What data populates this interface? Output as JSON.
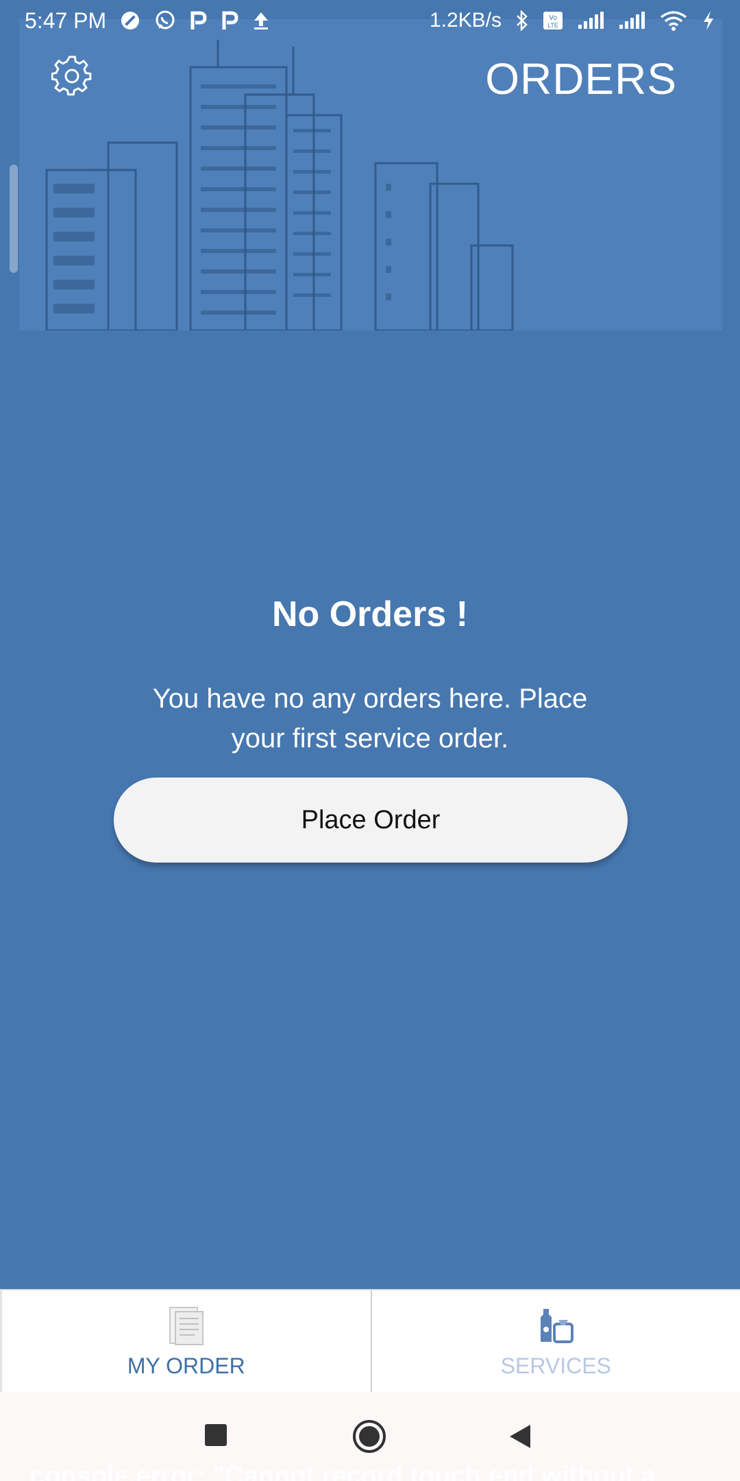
{
  "status_bar": {
    "time": "5:47 PM",
    "net_speed": "1.2KB/s",
    "icons": [
      "dnd-icon",
      "whatsapp-icon",
      "p-app-icon",
      "p-app-icon",
      "upload-icon",
      "bluetooth-icon",
      "volte-icon",
      "signal-icon",
      "signal-icon",
      "wifi-icon",
      "charging-icon"
    ]
  },
  "header": {
    "title": "ORDERS",
    "settings_icon": "gear-icon"
  },
  "empty_state": {
    "title": "No Orders !",
    "message": "You have no any orders here. Place your first service order.",
    "button_label": "Place Order"
  },
  "bottom_nav": {
    "items": [
      {
        "label": "MY ORDER",
        "icon": "document-icon",
        "active": true
      },
      {
        "label": "SERVICES",
        "icon": "tools-icon",
        "active": false
      }
    ]
  },
  "system_nav": {
    "buttons": [
      "recents-icon",
      "home-icon",
      "back-icon"
    ],
    "overlay_text": "console.error: \"Cannot record touch end without a"
  },
  "colors": {
    "background": "#4677AF",
    "header_bg": "#4F80B9",
    "button_bg": "#F3F3F3",
    "nav_active": "#3E6FA7",
    "nav_inactive": "#B8C8E2"
  }
}
